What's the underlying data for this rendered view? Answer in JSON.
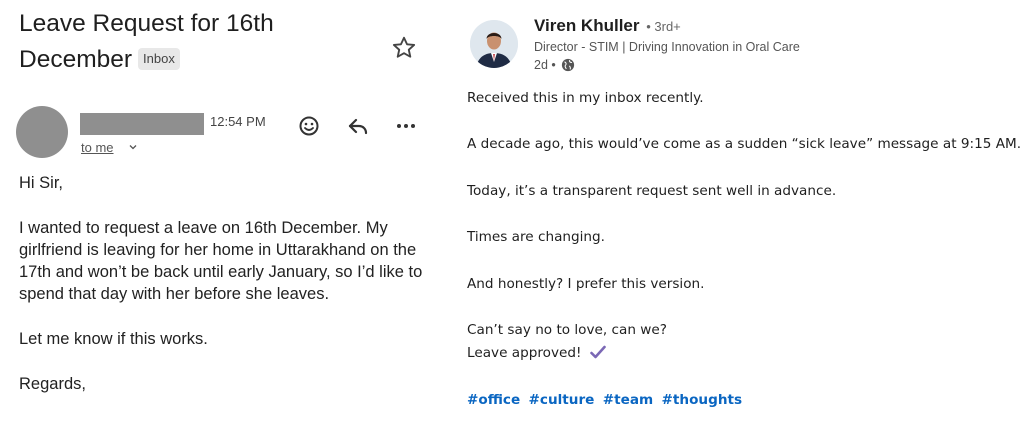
{
  "email": {
    "subject": "Leave Request for 16th December",
    "label": "Inbox",
    "time": "12:54 PM",
    "recipient": "to me",
    "body": {
      "greeting": "Hi Sir,",
      "paragraph": "I wanted to request a leave on 16th December. My girlfriend is leaving for her home in Uttarakhand on the 17th and won’t be back until early January, so I’d like to spend that day with her before she leaves.",
      "request": "Let me know if this works.",
      "closing": "Regards,"
    },
    "icons": [
      "star-icon",
      "emoji-icon",
      "reply-icon",
      "more-icon"
    ]
  },
  "post": {
    "author": {
      "name": "Viren Khuller",
      "degree": "• 3rd+",
      "headline": "Director - STIM | Driving Innovation in Oral Care",
      "time": "2d •"
    },
    "paragraphs": [
      "Received this in my inbox recently.",
      "A decade ago, this would’ve come as a sudden “sick leave” message at 9:15 AM.",
      "Today, it’s a transparent request sent well in advance.",
      "Times are changing.",
      "And honestly? I prefer this version."
    ],
    "closing_lines": [
      "Can’t say no to love, can we?",
      "Leave approved!"
    ],
    "hashtags": [
      "#office",
      "#culture",
      "#team",
      "#thoughts"
    ],
    "colors": {
      "hashtag": "#0a66c2",
      "check": "#7b68b5"
    }
  }
}
